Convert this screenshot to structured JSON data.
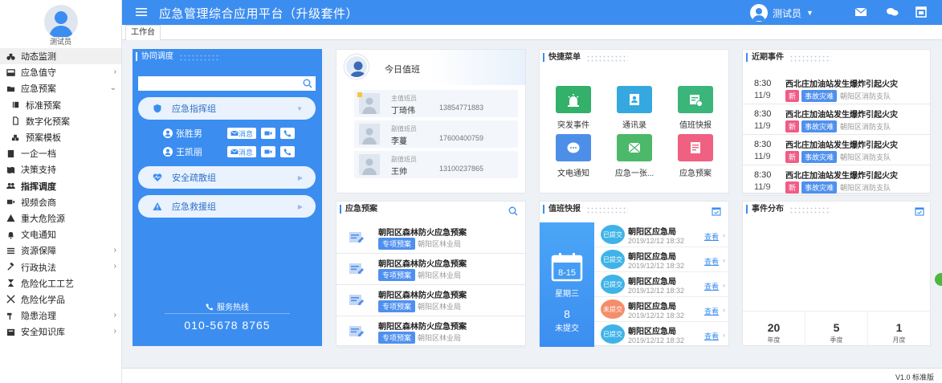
{
  "user": {
    "name": "测试员"
  },
  "app": {
    "title": "应急管理综合应用平台（升级套件）"
  },
  "sidebar": {
    "items": [
      {
        "label": "动态监测",
        "icon": "binoculars-icon",
        "arrow": ""
      },
      {
        "label": "应急值守",
        "icon": "inbox-icon",
        "arrow": "›"
      },
      {
        "label": "应急预案",
        "icon": "folder-icon",
        "arrow": "⌄"
      },
      {
        "label": "标准预案",
        "icon": "book-icon",
        "arrow": ""
      },
      {
        "label": "数字化预案",
        "icon": "doc-icon",
        "arrow": ""
      },
      {
        "label": "预案模板",
        "icon": "cubes-icon",
        "arrow": ""
      },
      {
        "label": "一企一档",
        "icon": "building-icon",
        "arrow": ""
      },
      {
        "label": "决策支持",
        "icon": "map-icon",
        "arrow": ""
      },
      {
        "label": "指挥调度",
        "icon": "users-icon",
        "arrow": ""
      },
      {
        "label": "视频会商",
        "icon": "video-icon",
        "arrow": ""
      },
      {
        "label": "重大危险源",
        "icon": "warning-icon",
        "arrow": ""
      },
      {
        "label": "文电通知",
        "icon": "bell-icon",
        "arrow": ""
      },
      {
        "label": "资源保障",
        "icon": "list-icon",
        "arrow": "›"
      },
      {
        "label": "行政执法",
        "icon": "gavel-icon",
        "arrow": "›"
      },
      {
        "label": "危险化工工艺",
        "icon": "hourglass-icon",
        "arrow": ""
      },
      {
        "label": "危险化学品",
        "icon": "flask-icon",
        "arrow": ""
      },
      {
        "label": "隐患治理",
        "icon": "hammer-icon",
        "arrow": "›"
      },
      {
        "label": "安全知识库",
        "icon": "box-icon",
        "arrow": "›"
      }
    ]
  },
  "tabs": {
    "workbench": "工作台"
  },
  "coordination": {
    "title": "协同调度",
    "groups": [
      "应急指挥组",
      "安全疏散组",
      "应急救援组"
    ],
    "members": [
      {
        "name": "张胜男",
        "msg": "消息"
      },
      {
        "name": "王凯丽",
        "msg": "消息"
      }
    ],
    "hotline_label": "服务热线",
    "hotline": "010-5678 8765"
  },
  "duty": {
    "title": "今日值班",
    "rows": [
      {
        "role": "主值班员",
        "name": "丁琦伟",
        "phone": "13854771883"
      },
      {
        "role": "副值班员",
        "name": "李蔓",
        "phone": "17600400759"
      },
      {
        "role": "副值班员",
        "name": "王帅",
        "phone": "13100237865"
      }
    ]
  },
  "quick": {
    "title": "快捷菜单",
    "items": [
      {
        "label": "突发事件",
        "color": "#33b06a"
      },
      {
        "label": "通讯录",
        "color": "#36a8e0"
      },
      {
        "label": "值班快报",
        "color": "#3bb57a"
      },
      {
        "label": "文电通知",
        "color": "#4d8ee8"
      },
      {
        "label": "应急一张...",
        "color": "#4bb86a"
      },
      {
        "label": "应急预案",
        "color": "#f06080"
      }
    ]
  },
  "recent": {
    "title": "近期事件",
    "items": [
      {
        "time": "8:30",
        "date": "11/9",
        "title": "西北庄加油站发生爆炸引起火灾",
        "tag1": "新",
        "tag2": "事故灾难",
        "org": "朝阳区消防支队"
      },
      {
        "time": "8:30",
        "date": "11/9",
        "title": "西北庄加油站发生爆炸引起火灾",
        "tag1": "新",
        "tag2": "事故灾难",
        "org": "朝阳区消防支队"
      },
      {
        "time": "8:30",
        "date": "11/9",
        "title": "西北庄加油站发生爆炸引起火灾",
        "tag1": "新",
        "tag2": "事故灾难",
        "org": "朝阳区消防支队"
      },
      {
        "time": "8:30",
        "date": "11/9",
        "title": "西北庄加油站发生爆炸引起火灾",
        "tag1": "新",
        "tag2": "事故灾难",
        "org": "朝阳区消防支队"
      }
    ]
  },
  "plan": {
    "title": "应急预案",
    "items": [
      {
        "title": "朝阳区森林防火应急预案",
        "tag": "专项预案",
        "org": "朝阳区林业局"
      },
      {
        "title": "朝阳区森林防火应急预案",
        "tag": "专项预案",
        "org": "朝阳区林业局"
      },
      {
        "title": "朝阳区森林防火应急预案",
        "tag": "专项预案",
        "org": "朝阳区林业局"
      },
      {
        "title": "朝阳区森林防火应急预案",
        "tag": "专项预案",
        "org": "朝阳区林业局"
      }
    ]
  },
  "report": {
    "title": "值班快报",
    "cal_date": "8-15",
    "weekday": "星期三",
    "count": "8",
    "count_label": "未提交",
    "items": [
      {
        "status": "已提交",
        "warn": false,
        "title": "朝阳区应急局",
        "date": "2019/12/12 18:32",
        "view": "查看"
      },
      {
        "status": "已提交",
        "warn": false,
        "title": "朝阳区应急局",
        "date": "2019/12/12 18:32",
        "view": "查看"
      },
      {
        "status": "已提交",
        "warn": false,
        "title": "朝阳区应急局",
        "date": "2019/12/12 18:32",
        "view": "查看"
      },
      {
        "status": "未提交",
        "warn": true,
        "title": "朝阳区应急局",
        "date": "2019/12/12 18:32",
        "view": "查看"
      },
      {
        "status": "已提交",
        "warn": false,
        "title": "朝阳区应急局",
        "date": "2019/12/12 18:32",
        "view": "查看"
      }
    ]
  },
  "dist": {
    "title": "事件分布",
    "stats": [
      {
        "num": "20",
        "label": "年度"
      },
      {
        "num": "5",
        "label": "季度"
      },
      {
        "num": "1",
        "label": "月度"
      }
    ]
  },
  "footer": {
    "version": "V1.0 标准版"
  },
  "colors": {
    "primary": "#3c8df0",
    "pink": "#f05c87"
  }
}
